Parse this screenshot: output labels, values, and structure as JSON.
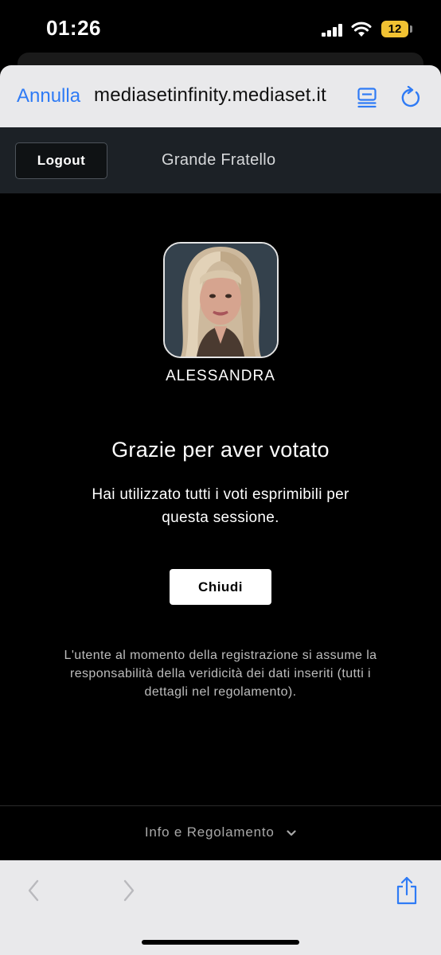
{
  "status_bar": {
    "time": "01:26",
    "battery": "12"
  },
  "browser": {
    "cancel_label": "Annulla",
    "url": "mediasetinfinity.mediaset.it",
    "accent": "#2f7bf5"
  },
  "app_header": {
    "logout_label": "Logout",
    "show_title": "Grande Fratello"
  },
  "vote": {
    "candidate_name": "ALESSANDRA",
    "thanks_title": "Grazie per aver votato",
    "info_text": "Hai utilizzato tutti i voti esprimibili per questa sessione.",
    "close_label": "Chiudi",
    "disclaimer": "L'utente al momento della registrazione si assume la responsabilità della veridicità dei dati inseriti (tutti i dettagli nel regolamento)."
  },
  "footer": {
    "link_label": "Info e Regolamento"
  },
  "icons": [
    "cellular-icon",
    "wifi-icon",
    "battery-icon",
    "reader-icon",
    "reload-icon",
    "chevron-down-icon",
    "back-icon",
    "forward-icon",
    "share-icon"
  ]
}
